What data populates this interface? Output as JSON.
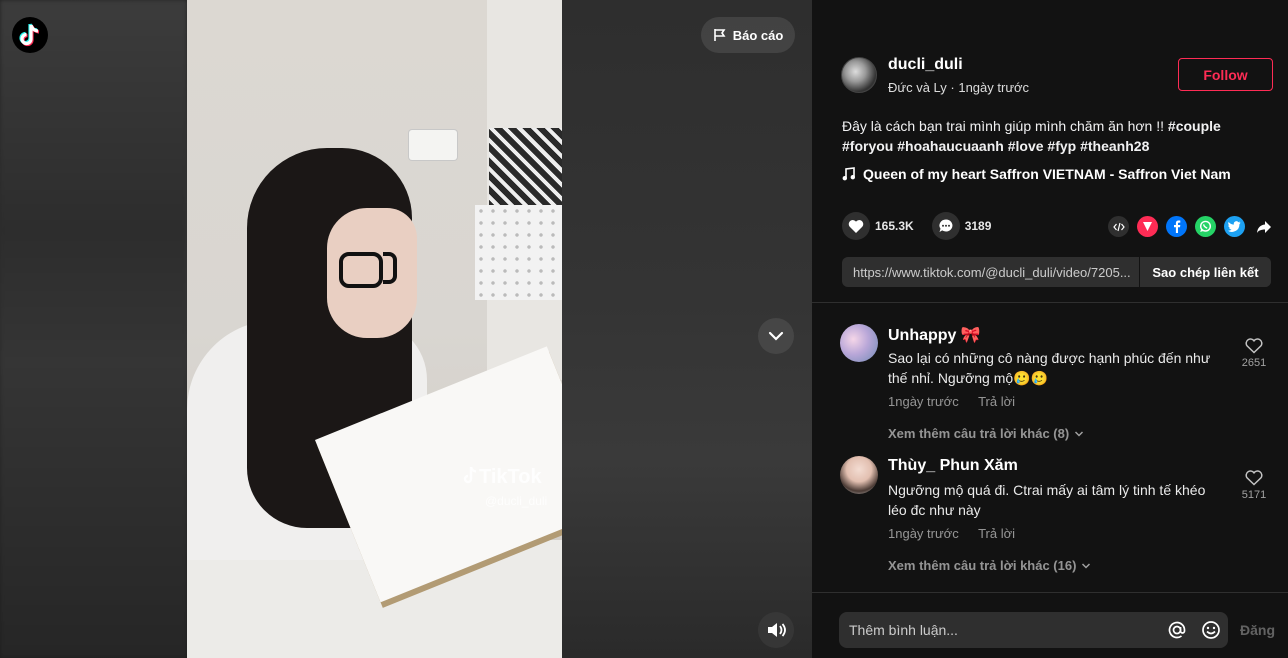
{
  "video": {
    "report_label": "Báo cáo",
    "watermark_brand": "TikTok",
    "watermark_user": "@ducli_duli",
    "logo_icon": "tiktok-logo-icon",
    "nav_icon": "chevron-down-icon",
    "volume_icon": "speaker-icon"
  },
  "author": {
    "username": "ducli_duli",
    "subtitle": "Đức và Ly · 1ngày trước",
    "follow_label": "Follow"
  },
  "post": {
    "caption": "Đây là cách bạn trai mình giúp mình chăm ăn hơn !! ",
    "hashtags": [
      "#couple",
      "#foryou",
      "#hoahaucuaanh",
      "#love",
      "#fyp",
      "#theanh28"
    ],
    "music": "Queen of my heart Saffron VIETNAM - Saffron Viet Nam",
    "likes": "165.3K",
    "comments": "3189"
  },
  "share": {
    "url": "https://www.tiktok.com/@ducli_duli/video/7205...",
    "copy_label": "Sao chép liên kết",
    "icons": [
      "embed-icon",
      "send-icon",
      "facebook-icon",
      "whatsapp-icon",
      "twitter-icon",
      "share-arrow-icon"
    ]
  },
  "comments": [
    {
      "username": "Unhappy 🎀",
      "text": "Sao lại có những cô nàng được hạnh phúc đến như thế nhỉ. Ngưỡng mộ🥲🥲",
      "time": "1ngày trước",
      "reply_label": "Trả lời",
      "likes": "2651",
      "more_replies": "Xem thêm câu trả lời khác (8)"
    },
    {
      "username": "Thùy_ Phun Xăm",
      "text": "Ngưỡng mộ quá đi. Ctrai mấy ai tâm lý tinh tế khéo léo đc như này",
      "time": "1ngày trước",
      "reply_label": "Trả lời",
      "likes": "5171",
      "more_replies": "Xem thêm câu trả lời khác (16)"
    }
  ],
  "composer": {
    "placeholder": "Thêm bình luận...",
    "post_label": "Đăng"
  },
  "colors": {
    "accent": "#fe2c55",
    "panel_bg": "#121212",
    "chip_bg": "#2f2f2f"
  }
}
